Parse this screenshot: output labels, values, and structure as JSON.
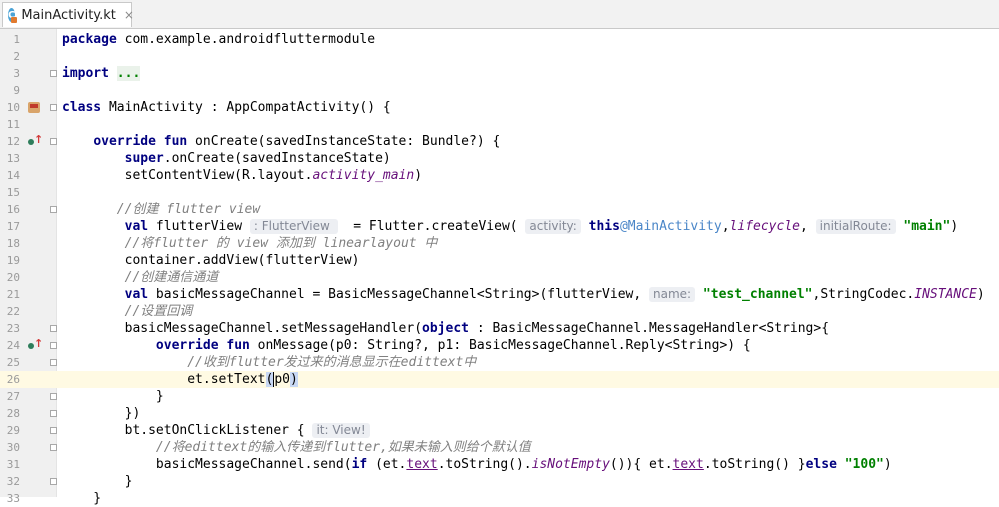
{
  "tab": {
    "title": "MainActivity.kt",
    "close": "×"
  },
  "lines": [
    {
      "n": "1",
      "segs": [
        {
          "t": "package",
          "c": "kw"
        },
        {
          "t": " com.example.androidfluttermodule"
        }
      ]
    },
    {
      "n": "2",
      "segs": []
    },
    {
      "n": "3",
      "segs": [
        {
          "t": "import",
          "c": "kw"
        },
        {
          "t": " "
        },
        {
          "t": "...",
          "c": "imp str"
        }
      ]
    },
    {
      "n": "9",
      "segs": []
    },
    {
      "n": "10",
      "segs": [
        {
          "t": "class",
          "c": "kw"
        },
        {
          "t": " MainActivity : AppCompatActivity() {"
        }
      ]
    },
    {
      "n": "11",
      "segs": []
    },
    {
      "n": "12",
      "segs": [
        {
          "t": "    "
        },
        {
          "t": "override fun",
          "c": "kw"
        },
        {
          "t": " onCreate(savedInstanceState: Bundle?) {"
        }
      ]
    },
    {
      "n": "13",
      "segs": [
        {
          "t": "        "
        },
        {
          "t": "super",
          "c": "kw"
        },
        {
          "t": ".onCreate(savedInstanceState)"
        }
      ]
    },
    {
      "n": "14",
      "segs": [
        {
          "t": "        setContentView(R.layout."
        },
        {
          "t": "activity_main",
          "c": "it"
        },
        {
          "t": ")"
        }
      ]
    },
    {
      "n": "15",
      "segs": []
    },
    {
      "n": "16",
      "segs": [
        {
          "t": "       "
        },
        {
          "t": "//创建 flutter view",
          "c": "cm"
        }
      ]
    },
    {
      "n": "17",
      "segs": [
        {
          "t": "        "
        },
        {
          "t": "val",
          "c": "kw"
        },
        {
          "t": " flutterView "
        },
        {
          "t": ": FlutterView ",
          "c": "hint"
        },
        {
          "t": "  = Flutter.createView( "
        },
        {
          "t": "activity:",
          "c": "hint"
        },
        {
          "t": " "
        },
        {
          "t": "this",
          "c": "kw"
        },
        {
          "t": "@MainActivity",
          "c": "lab"
        },
        {
          "t": ","
        },
        {
          "t": "lifecycle",
          "c": "it"
        },
        {
          "t": ", "
        },
        {
          "t": "initialRoute:",
          "c": "hint"
        },
        {
          "t": " "
        },
        {
          "t": "\"main\"",
          "c": "str"
        },
        {
          "t": ")"
        }
      ]
    },
    {
      "n": "18",
      "segs": [
        {
          "t": "        "
        },
        {
          "t": "//将flutter 的 view 添加到 linearlayout 中",
          "c": "cm"
        }
      ]
    },
    {
      "n": "19",
      "segs": [
        {
          "t": "        container.addView(flutterView)"
        }
      ]
    },
    {
      "n": "20",
      "segs": [
        {
          "t": "        "
        },
        {
          "t": "//创建通信通道",
          "c": "cm"
        }
      ]
    },
    {
      "n": "21",
      "segs": [
        {
          "t": "        "
        },
        {
          "t": "val",
          "c": "kw"
        },
        {
          "t": " basicMessageChannel = BasicMessageChannel<String>(flutterView, "
        },
        {
          "t": "name:",
          "c": "hint"
        },
        {
          "t": " "
        },
        {
          "t": "\"test_channel\"",
          "c": "str"
        },
        {
          "t": ",StringCodec."
        },
        {
          "t": "INSTANCE",
          "c": "it"
        },
        {
          "t": ")"
        }
      ]
    },
    {
      "n": "22",
      "segs": [
        {
          "t": "        "
        },
        {
          "t": "//设置回调",
          "c": "cm"
        }
      ]
    },
    {
      "n": "23",
      "segs": [
        {
          "t": "        basicMessageChannel.setMessageHandler("
        },
        {
          "t": "object",
          "c": "kw"
        },
        {
          "t": " : BasicMessageChannel.MessageHandler<String>{"
        }
      ]
    },
    {
      "n": "24",
      "segs": [
        {
          "t": "            "
        },
        {
          "t": "override fun",
          "c": "kw"
        },
        {
          "t": " onMessage(p0: String?, p1: BasicMessageChannel.Reply<String>) {"
        }
      ]
    },
    {
      "n": "25",
      "segs": [
        {
          "t": "                "
        },
        {
          "t": "//收到flutter发过来的消息显示在edittext中",
          "c": "cm"
        }
      ]
    },
    {
      "n": "26",
      "segs": [
        {
          "t": "                et.setText"
        },
        {
          "t": "(",
          "c": "hl"
        },
        {
          "t": "p0"
        },
        {
          "t": ")",
          "c": "hl"
        }
      ]
    },
    {
      "n": "27",
      "segs": [
        {
          "t": "            }"
        }
      ]
    },
    {
      "n": "28",
      "segs": [
        {
          "t": "        })"
        }
      ]
    },
    {
      "n": "29",
      "segs": [
        {
          "t": "        bt.setOnClickListener { "
        },
        {
          "t": "it: View!",
          "c": "hint"
        }
      ]
    },
    {
      "n": "30",
      "segs": [
        {
          "t": "            "
        },
        {
          "t": "//将edittext的输入传递到flutter,如果未输入则给个默认值",
          "c": "cm"
        }
      ]
    },
    {
      "n": "31",
      "segs": [
        {
          "t": "            basicMessageChannel.send("
        },
        {
          "t": "if",
          "c": "kw"
        },
        {
          "t": " (et."
        },
        {
          "t": "text",
          "c": "lk"
        },
        {
          "t": ".toString()."
        },
        {
          "t": "isNotEmpty",
          "c": "it"
        },
        {
          "t": "()){ et."
        },
        {
          "t": "text",
          "c": "lk"
        },
        {
          "t": ".toString() }"
        },
        {
          "t": "else",
          "c": "kw"
        },
        {
          "t": " "
        },
        {
          "t": "\"100\"",
          "c": "str"
        },
        {
          "t": ")"
        }
      ]
    },
    {
      "n": "32",
      "segs": [
        {
          "t": "        }"
        }
      ]
    },
    {
      "n": "33",
      "segs": [
        {
          "t": "    }"
        }
      ]
    }
  ],
  "gutter": {
    "current_line": "26",
    "class_icon_line": "10",
    "override_icon_lines": [
      "12",
      "24"
    ],
    "fold_lines": [
      "3",
      "10",
      "12",
      "16",
      "23",
      "24",
      "25",
      "27",
      "28",
      "29",
      "30",
      "32"
    ]
  },
  "colors": {
    "keyword": "#000080",
    "string": "#008000",
    "comment": "#808080",
    "field": "#660e7a",
    "current_line_bg": "#fffae3"
  }
}
